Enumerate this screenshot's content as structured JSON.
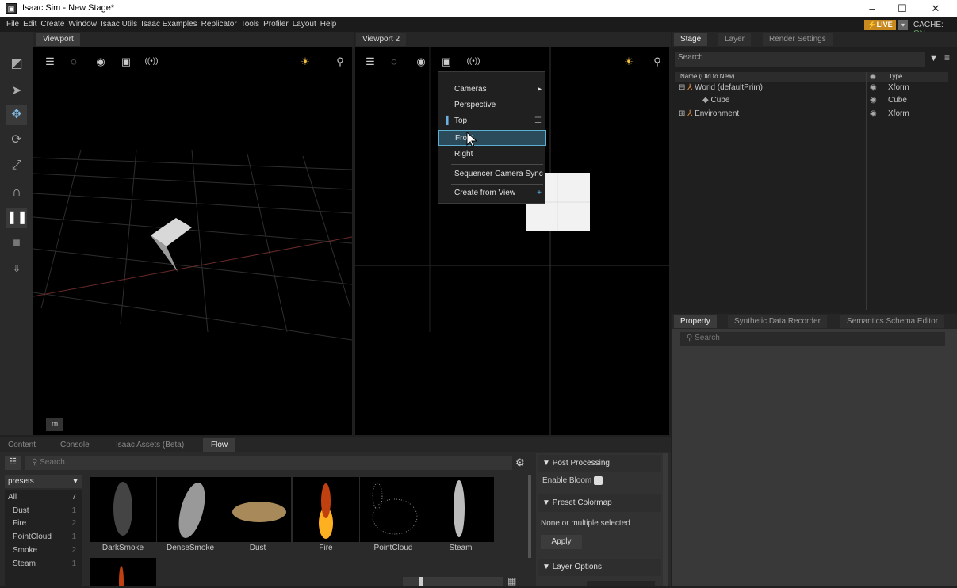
{
  "window": {
    "title": "Isaac Sim  - New Stage*",
    "app_icon": "isaac-sim-icon",
    "controls": {
      "minimize": "–",
      "maximize": "☐",
      "close": "✕"
    }
  },
  "menubar": {
    "items": [
      "File",
      "Edit",
      "Create",
      "Window",
      "Isaac Utils",
      "Isaac Examples",
      "Replicator",
      "Tools",
      "Profiler",
      "Layout",
      "Help"
    ],
    "live_label": "LIVE",
    "cache_label": "CACHE:",
    "cache_state": "ON"
  },
  "viewports": [
    {
      "tab": "Viewport",
      "bottom_badge": "m"
    },
    {
      "tab": "Viewport 2"
    }
  ],
  "camera_menu": {
    "items": [
      "Cameras",
      "Perspective",
      "Top",
      "Front",
      "Right",
      "Sequencer Camera Sync",
      "Create from View"
    ],
    "highlighted": "Front",
    "checked": "Top"
  },
  "stage_panel": {
    "tabs": [
      "Stage",
      "Layer",
      "Render Settings"
    ],
    "search_placeholder": "Search",
    "columns": {
      "name": "Name (Old to New)",
      "type": "Type"
    },
    "rows": [
      {
        "name": "World (defaultPrim)",
        "type": "Xform"
      },
      {
        "name": "Cube",
        "type": "Cube"
      },
      {
        "name": "Environment",
        "type": "Xform"
      }
    ]
  },
  "property_panel": {
    "tabs": [
      "Property",
      "Synthetic Data Recorder",
      "Semantics Schema Editor"
    ],
    "search_placeholder": "Search"
  },
  "bottom_panel": {
    "tabs": [
      "Content",
      "Console",
      "Isaac Assets (Beta)",
      "Flow"
    ],
    "search_placeholder": "Search",
    "preset_dropdown": "presets",
    "presets": [
      {
        "name": "All",
        "count": "7"
      },
      {
        "name": "Dust",
        "count": "1"
      },
      {
        "name": "Fire",
        "count": "2"
      },
      {
        "name": "PointCloud",
        "count": "1"
      },
      {
        "name": "Smoke",
        "count": "2"
      },
      {
        "name": "Steam",
        "count": "1"
      }
    ],
    "thumbnails": [
      "DarkSmoke",
      "DenseSmoke",
      "Dust",
      "Fire",
      "PointCloud",
      "Steam"
    ],
    "post_processing": {
      "header": "Post Processing",
      "enable_bloom": "Enable Bloom",
      "colormap_header": "Preset Colormap",
      "selection_text": "None or multiple selected",
      "apply_label": "Apply",
      "layer_options": "Layer Options"
    }
  }
}
